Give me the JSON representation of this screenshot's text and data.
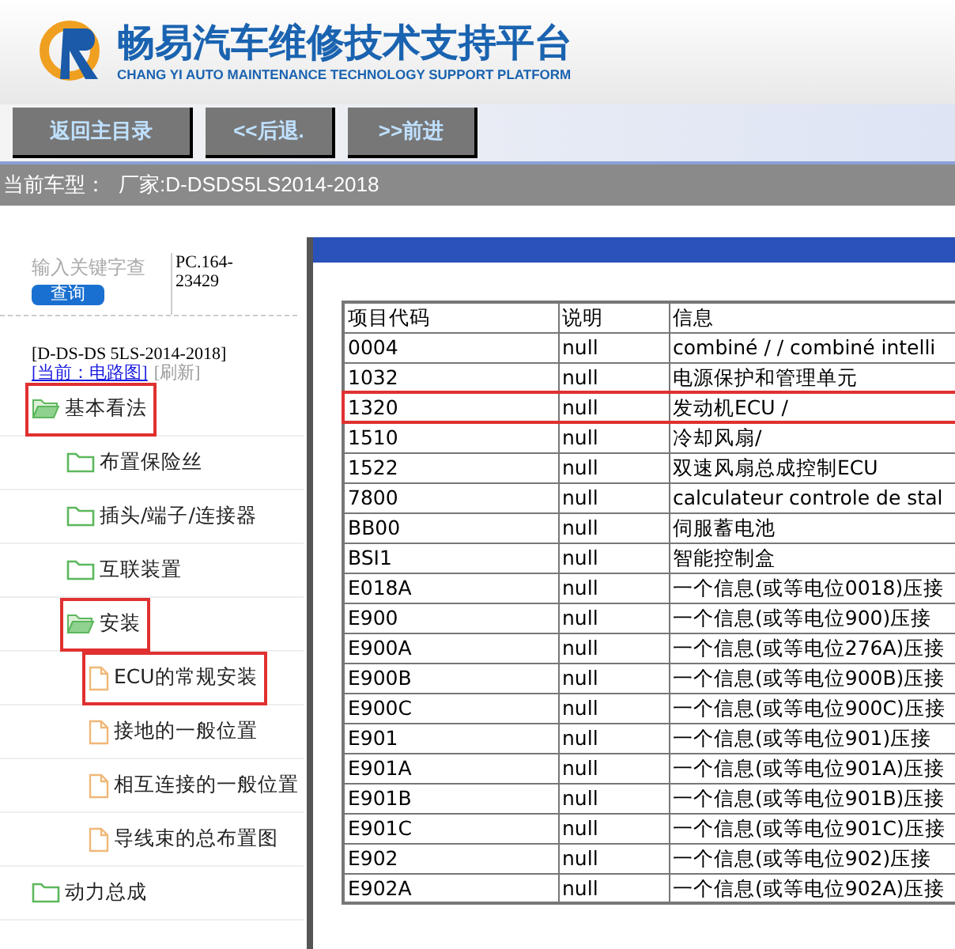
{
  "header": {
    "title": "畅易汽车维修技术支持平台",
    "subtitle": "CHANG YI AUTO MAINTENANCE TECHNOLOGY SUPPORT PLATFORM"
  },
  "nav_buttons": [
    "返回主目录",
    "<<后退.",
    ">>前进"
  ],
  "vehicle_bar": {
    "label": "当前车型：",
    "value": "厂家:D-DSDS5LS2014-2018"
  },
  "search": {
    "placeholder": "输入关键字查",
    "button": "查询",
    "code": "PC.164-23429"
  },
  "model": {
    "name": "[D-DS-DS 5LS-2014-2018]",
    "current": "[当前：电路图]",
    "refresh": "[刷新]"
  },
  "tree": [
    {
      "label": "基本看法",
      "kind": "folder",
      "expanded": true,
      "highlighted": true,
      "children": [
        {
          "label": "布置保险丝",
          "kind": "folder",
          "expanded": false,
          "highlighted": false
        },
        {
          "label": "插头/端子/连接器",
          "kind": "folder",
          "expanded": false,
          "highlighted": false
        },
        {
          "label": "互联装置",
          "kind": "folder",
          "expanded": false,
          "highlighted": false
        },
        {
          "label": "安装",
          "kind": "folder",
          "expanded": true,
          "highlighted": true,
          "children": [
            {
              "label": "ECU的常规安装",
              "kind": "document",
              "highlighted": true
            },
            {
              "label": "接地的一般位置",
              "kind": "document",
              "highlighted": false
            },
            {
              "label": "相互连接的一般位置",
              "kind": "document",
              "highlighted": false
            },
            {
              "label": "导线束的总布置图",
              "kind": "document",
              "highlighted": false
            }
          ]
        }
      ]
    },
    {
      "label": "动力总成",
      "kind": "folder",
      "expanded": false,
      "highlighted": false
    }
  ],
  "table": {
    "columns": [
      "项目代码",
      "说明",
      "信息"
    ],
    "rows": [
      {
        "cells": [
          "0004",
          "null",
          "combiné / / combiné intelli"
        ],
        "highlighted": false
      },
      {
        "cells": [
          "1032",
          "null",
          "电源保护和管理单元"
        ],
        "highlighted": false
      },
      {
        "cells": [
          "1320",
          "null",
          "发动机ECU /"
        ],
        "highlighted": true
      },
      {
        "cells": [
          "1510",
          "null",
          "冷却风扇/"
        ],
        "highlighted": false
      },
      {
        "cells": [
          "1522",
          "null",
          "双速风扇总成控制ECU"
        ],
        "highlighted": false
      },
      {
        "cells": [
          "7800",
          "null",
          "calculateur controle de stal"
        ],
        "highlighted": false
      },
      {
        "cells": [
          "BB00",
          "null",
          "伺服蓄电池"
        ],
        "highlighted": false
      },
      {
        "cells": [
          "BSI1",
          "null",
          "智能控制盒"
        ],
        "highlighted": false
      },
      {
        "cells": [
          "E018A",
          "null",
          "一个信息(或等电位0018)压接"
        ],
        "highlighted": false
      },
      {
        "cells": [
          "E900",
          "null",
          "一个信息(或等电位900)压接"
        ],
        "highlighted": false
      },
      {
        "cells": [
          "E900A",
          "null",
          "一个信息(或等电位276A)压接"
        ],
        "highlighted": false
      },
      {
        "cells": [
          "E900B",
          "null",
          "一个信息(或等电位900B)压接"
        ],
        "highlighted": false
      },
      {
        "cells": [
          "E900C",
          "null",
          "一个信息(或等电位900C)压接"
        ],
        "highlighted": false
      },
      {
        "cells": [
          "E901",
          "null",
          "一个信息(或等电位901)压接"
        ],
        "highlighted": false
      },
      {
        "cells": [
          "E901A",
          "null",
          "一个信息(或等电位901A)压接"
        ],
        "highlighted": false
      },
      {
        "cells": [
          "E901B",
          "null",
          "一个信息(或等电位901B)压接"
        ],
        "highlighted": false
      },
      {
        "cells": [
          "E901C",
          "null",
          "一个信息(或等电位901C)压接"
        ],
        "highlighted": false
      },
      {
        "cells": [
          "E902",
          "null",
          "一个信息(或等电位902)压接"
        ],
        "highlighted": false
      },
      {
        "cells": [
          "E902A",
          "null",
          "一个信息(或等电位902A)压接"
        ],
        "highlighted": false
      }
    ]
  }
}
